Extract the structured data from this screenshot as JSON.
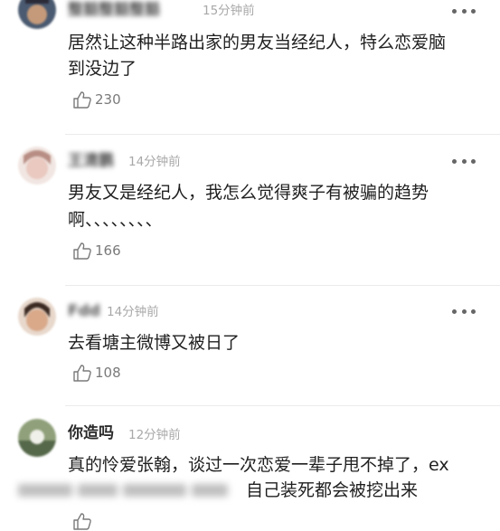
{
  "comments": [
    {
      "username": "整豁整豁整豁",
      "time": "15分钟前",
      "lines": [
        "居然让这种半路出家的男友当经纪人，特么恋爱脑",
        "到没边了"
      ],
      "likes": "230",
      "avatar_colors": [
        "#4a5a70",
        "#c49a7a"
      ]
    },
    {
      "username": "王清鹏",
      "time": "14分钟前",
      "lines": [
        "男友又是经纪人，我怎么觉得爽子有被骗的趋势",
        "啊、、、、、、、、"
      ],
      "likes": "166",
      "avatar_colors": [
        "#e9c9c0",
        "#b88e84"
      ]
    },
    {
      "username": "Fdd",
      "time": "14分钟前",
      "lines": [
        "去看塘主微博又被日了"
      ],
      "likes": "108",
      "avatar_colors": [
        "#3b2a22",
        "#d9a98a"
      ]
    },
    {
      "username": "你造吗",
      "time": "12分钟前",
      "lines": [
        "真的怜爱张翰，谈过一次恋爱一辈子甩不掉了，ex",
        "自己装死都会被挖出来"
      ],
      "likes": "",
      "avatar_colors": [
        "#55684a",
        "#8fa07a"
      ]
    }
  ],
  "colors": {
    "text": "#1f1f1f",
    "meta": "#a8a8a8",
    "icon": "#7a7a7a",
    "divider": "#ebebeb"
  },
  "icons": {
    "like": "thumbs-up-icon",
    "more": "more-dots-icon"
  }
}
